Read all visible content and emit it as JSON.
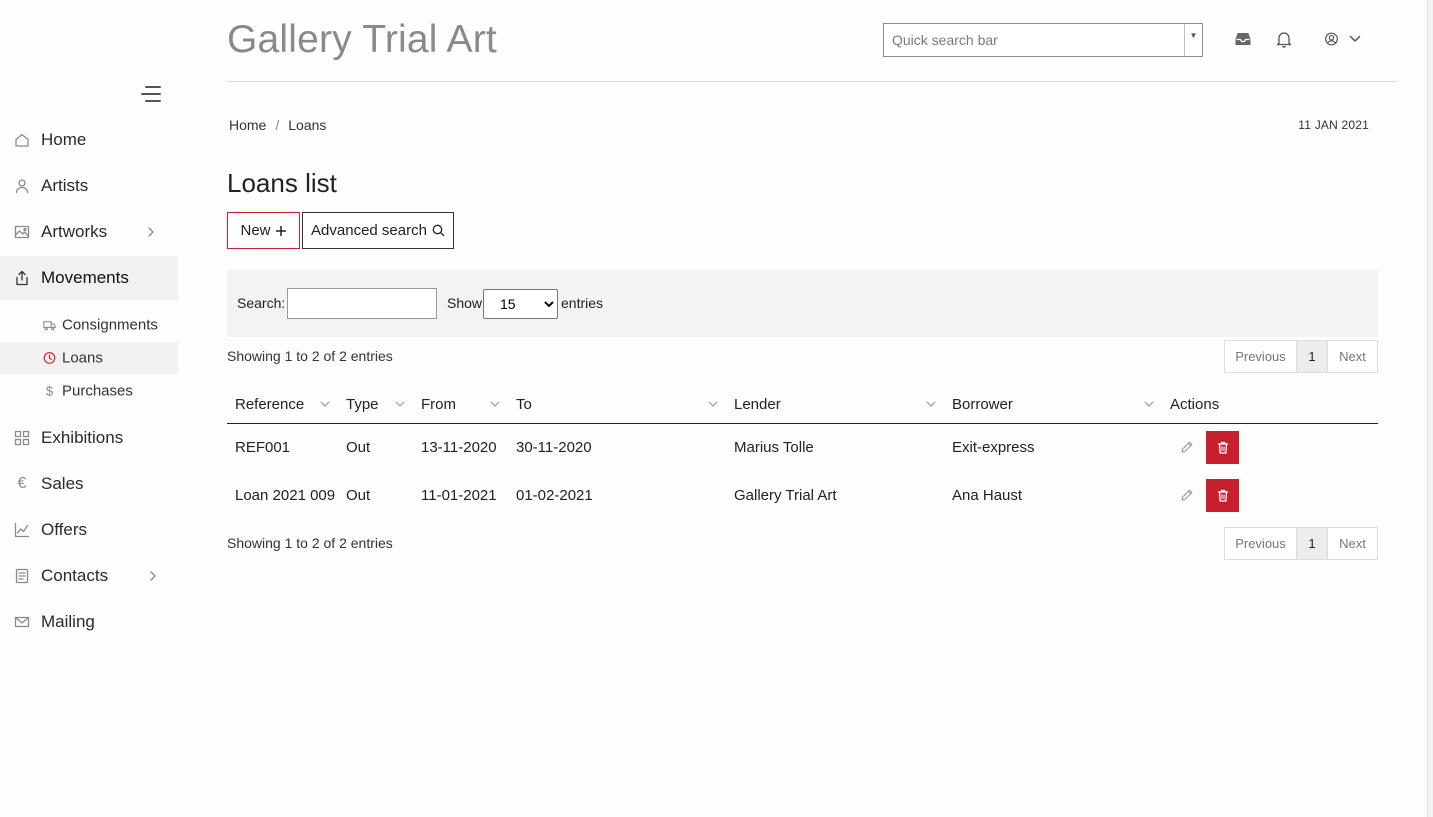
{
  "app": {
    "title": "Gallery Trial Art"
  },
  "header": {
    "search_placeholder": "Quick search bar"
  },
  "sidebar": {
    "items": [
      {
        "label": "Home",
        "icon": "home-icon"
      },
      {
        "label": "Artists",
        "icon": "user-icon"
      },
      {
        "label": "Artworks",
        "icon": "image-icon",
        "has_children": true
      },
      {
        "label": "Movements",
        "icon": "share-icon",
        "active": true
      },
      {
        "label": "Exhibitions",
        "icon": "grid-icon"
      },
      {
        "label": "Sales",
        "icon": "euro-icon"
      },
      {
        "label": "Offers",
        "icon": "chart-icon"
      },
      {
        "label": "Contacts",
        "icon": "contacts-icon",
        "has_children": true
      },
      {
        "label": "Mailing",
        "icon": "mail-icon"
      }
    ],
    "sub_items": [
      {
        "label": "Consignments",
        "icon": "truck-icon"
      },
      {
        "label": "Loans",
        "icon": "clock-icon",
        "active": true
      },
      {
        "label": "Purchases",
        "icon": "dollar-icon"
      }
    ]
  },
  "breadcrumb": {
    "home": "Home",
    "sep": "/",
    "current": "Loans"
  },
  "date": "11 JAN 2021",
  "page": {
    "title": "Loans list",
    "new_label": "New",
    "advanced_label": "Advanced search"
  },
  "filter": {
    "search_label": "Search:",
    "search_value": "",
    "show_label": "Show",
    "page_size": "15",
    "page_size_options": [
      "15"
    ],
    "entries_label": "entries"
  },
  "info_text": "Showing 1 to 2 of 2 entries",
  "pager": {
    "prev": "Previous",
    "current": "1",
    "next": "Next"
  },
  "table": {
    "columns": [
      "Reference",
      "Type",
      "From",
      "To",
      "Lender",
      "Borrower",
      "Actions"
    ],
    "rows": [
      {
        "reference": "REF001",
        "type": "Out",
        "from": "13-11-2020",
        "to": "30-11-2020",
        "lender": "Marius Tolle",
        "borrower": "Exit-express"
      },
      {
        "reference": "Loan 2021 009",
        "type": "Out",
        "from": "11-01-2021",
        "to": "01-02-2021",
        "lender": "Gallery Trial Art",
        "borrower": "Ana Haust"
      }
    ]
  },
  "colors": {
    "accent": "#c8202f",
    "title_gray": "#8a8a8a",
    "sidebar_active_bg": "#f1f1ef",
    "filter_bg": "#f3f2f4"
  }
}
